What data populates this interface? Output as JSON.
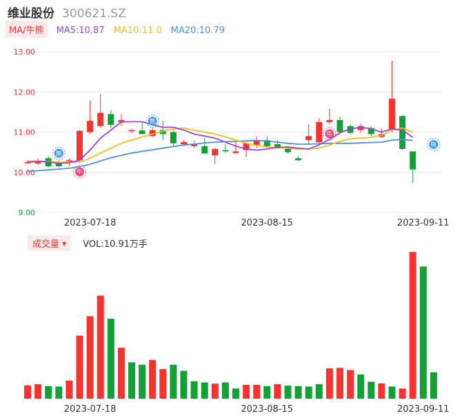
{
  "header": {
    "stock_name": "维业股份",
    "stock_code": "300621.SZ"
  },
  "ma_legend": {
    "tag": "MA/牛熊",
    "ma5": "MA5:10.87",
    "ma10": "MA10:11.0",
    "ma20": "MA20:10.79"
  },
  "volume_legend": {
    "tag": "成交量",
    "value": "VOL:10.91万手"
  },
  "colors": {
    "up": "#f5342f",
    "down": "#13a036",
    "ma5": "#9b44d6",
    "ma10": "#f2bd1b",
    "ma20": "#4a90e2",
    "axis_label": "#e83030",
    "low_label": "#13a036"
  },
  "icons": {
    "bull": "牛",
    "bear": "熊"
  },
  "chart_data": [
    {
      "type": "candlestick",
      "yticks": [
        {
          "label": "13.00",
          "value": 13.0
        },
        {
          "label": "12.00",
          "value": 12.0
        },
        {
          "label": "11.00",
          "value": 11.0
        },
        {
          "label": "10.00",
          "value": 10.0
        },
        {
          "label": "9.00",
          "value": 9.0
        }
      ],
      "ylim": [
        9.0,
        13.0
      ],
      "xticks": [
        {
          "label": "2023-07-18",
          "index": 6
        },
        {
          "label": "2023-08-15",
          "index": 23
        },
        {
          "label": "2023-09-11",
          "index": 38
        }
      ],
      "grid": true,
      "ohlc": [
        [
          10.25,
          10.3,
          10.2,
          10.25
        ],
        [
          10.22,
          10.35,
          10.18,
          10.28
        ],
        [
          10.35,
          10.4,
          10.12,
          10.15
        ],
        [
          10.25,
          10.3,
          10.12,
          10.15
        ],
        [
          10.28,
          10.34,
          10.15,
          10.3
        ],
        [
          10.3,
          11.05,
          10.25,
          11.03
        ],
        [
          11.0,
          11.78,
          10.95,
          11.28
        ],
        [
          11.15,
          11.95,
          11.1,
          11.48
        ],
        [
          11.45,
          11.55,
          11.1,
          11.18
        ],
        [
          11.25,
          11.45,
          11.15,
          11.3
        ],
        [
          11.02,
          11.08,
          10.98,
          11.05
        ],
        [
          11.04,
          11.25,
          10.95,
          10.95
        ],
        [
          10.9,
          11.1,
          10.88,
          11.05
        ],
        [
          11.05,
          11.28,
          10.8,
          10.95
        ],
        [
          11.0,
          11.05,
          10.65,
          10.72
        ],
        [
          10.7,
          10.8,
          10.65,
          10.75
        ],
        [
          10.65,
          10.8,
          10.6,
          10.7
        ],
        [
          10.65,
          10.85,
          10.45,
          10.47
        ],
        [
          10.42,
          10.6,
          10.2,
          10.58
        ],
        [
          10.55,
          10.7,
          10.48,
          10.52
        ],
        [
          10.48,
          10.8,
          10.46,
          10.52
        ],
        [
          10.55,
          10.75,
          10.38,
          10.72
        ],
        [
          10.68,
          10.9,
          10.6,
          10.78
        ],
        [
          10.8,
          10.9,
          10.6,
          10.65
        ],
        [
          10.7,
          10.8,
          10.6,
          10.6
        ],
        [
          10.58,
          10.65,
          10.46,
          10.5
        ],
        [
          10.35,
          10.4,
          10.28,
          10.3
        ],
        [
          10.8,
          11.2,
          10.7,
          10.9
        ],
        [
          10.75,
          11.35,
          10.7,
          11.25
        ],
        [
          11.25,
          11.58,
          11.2,
          11.3
        ],
        [
          11.3,
          11.38,
          10.95,
          11.0
        ],
        [
          11.15,
          11.2,
          10.95,
          10.98
        ],
        [
          11.05,
          11.22,
          10.98,
          11.15
        ],
        [
          11.1,
          11.15,
          10.9,
          10.95
        ],
        [
          10.88,
          11.1,
          10.85,
          10.95
        ],
        [
          11.05,
          12.78,
          11.0,
          11.83
        ],
        [
          11.4,
          11.42,
          10.55,
          10.58
        ],
        [
          10.52,
          10.52,
          9.73,
          10.07
        ]
      ],
      "ma5": [
        10.25,
        10.27,
        10.26,
        10.22,
        10.24,
        10.3,
        10.55,
        10.85,
        11.05,
        11.25,
        11.26,
        11.26,
        11.18,
        11.12,
        11.12,
        11.05,
        10.95,
        10.9,
        10.85,
        10.75,
        10.65,
        10.58,
        10.55,
        10.58,
        10.62,
        10.63,
        10.6,
        10.58,
        10.68,
        10.82,
        10.98,
        11.08,
        11.12,
        11.08,
        11.0,
        11.08,
        11.05,
        10.87
      ],
      "ma10": [
        10.28,
        10.28,
        10.27,
        10.25,
        10.25,
        10.25,
        10.35,
        10.48,
        10.6,
        10.72,
        10.8,
        10.88,
        10.95,
        11.02,
        11.08,
        11.1,
        11.05,
        11.0,
        10.95,
        10.88,
        10.8,
        10.72,
        10.67,
        10.63,
        10.62,
        10.6,
        10.58,
        10.58,
        10.6,
        10.68,
        10.77,
        10.83,
        10.85,
        10.87,
        10.92,
        11.05,
        11.1,
        11.0
      ],
      "ma20": [
        10.02,
        10.04,
        10.06,
        10.08,
        10.1,
        10.14,
        10.2,
        10.28,
        10.36,
        10.42,
        10.48,
        10.52,
        10.56,
        10.6,
        10.64,
        10.68,
        10.7,
        10.73,
        10.75,
        10.76,
        10.77,
        10.78,
        10.79,
        10.78,
        10.75,
        10.72,
        10.7,
        10.7,
        10.71,
        10.72,
        10.72,
        10.72,
        10.73,
        10.74,
        10.75,
        10.8,
        10.82,
        10.79
      ],
      "signals": [
        {
          "type": "bear",
          "index": 3
        },
        {
          "type": "bull",
          "index": 5
        },
        {
          "type": "bear",
          "index": 12
        },
        {
          "type": "bull",
          "index": 29
        },
        {
          "type": "bear",
          "index": 39
        }
      ]
    },
    {
      "type": "bar",
      "title": "成交量",
      "xticks": [
        {
          "label": "2023-07-18",
          "index": 6
        },
        {
          "label": "2023-08-15",
          "index": 23
        },
        {
          "label": "2023-09-11",
          "index": 38
        }
      ],
      "ylim": [
        0,
        62
      ],
      "values": [
        5.5,
        6.0,
        5.2,
        5.0,
        7.5,
        26.0,
        34.0,
        42.5,
        33.0,
        21.0,
        15.0,
        14.0,
        16.0,
        12.2,
        14.0,
        11.5,
        7.2,
        6.7,
        6.2,
        6.7,
        4.2,
        5.7,
        5.7,
        5.2,
        6.0,
        5.4,
        5.2,
        5.0,
        6.0,
        12.5,
        12.7,
        11.8,
        10.0,
        7.0,
        6.3,
        5.0,
        4.2,
        60.5,
        54.5,
        10.91
      ],
      "directions": [
        "up",
        "up",
        "down",
        "down",
        "up",
        "up",
        "up",
        "up",
        "down",
        "up",
        "down",
        "down",
        "up",
        "up",
        "down",
        "down",
        "down",
        "down",
        "up",
        "down",
        "down",
        "up",
        "up",
        "down",
        "up",
        "down",
        "down",
        "down",
        "down",
        "up",
        "up",
        "up",
        "down",
        "down",
        "up",
        "down",
        "up",
        "up",
        "down",
        "down"
      ]
    }
  ]
}
